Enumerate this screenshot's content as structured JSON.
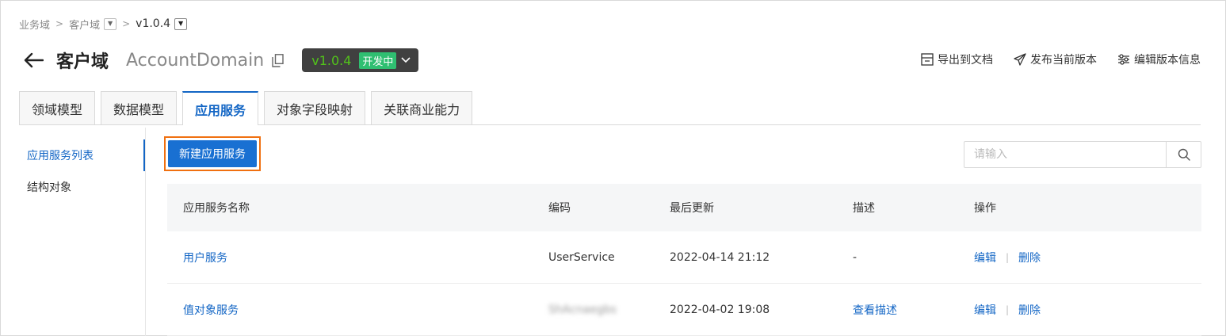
{
  "breadcrumb": {
    "items": [
      "业务域",
      "客户域",
      "v1.0.4"
    ]
  },
  "header": {
    "title": "客户域",
    "subtitle": "AccountDomain",
    "version": "v1.0.4",
    "version_status": "开发中",
    "actions": {
      "export": "导出到文档",
      "publish": "发布当前版本",
      "edit_info": "编辑版本信息"
    }
  },
  "tabs": [
    "领域模型",
    "数据模型",
    "应用服务",
    "对象字段映射",
    "关联商业能力"
  ],
  "active_tab": "应用服务",
  "sidebar": {
    "items": [
      "应用服务列表",
      "结构对象"
    ]
  },
  "toolbar": {
    "create_label": "新建应用服务"
  },
  "search": {
    "placeholder": "请输入"
  },
  "table": {
    "columns": [
      "应用服务名称",
      "编码",
      "最后更新",
      "描述",
      "操作"
    ],
    "rows": [
      {
        "name": "用户服务",
        "code": "UserService",
        "updated": "2022-04-14 21:12",
        "desc": "-",
        "edit": "编辑",
        "delete": "删除"
      },
      {
        "name": "值对象服务",
        "code": "ShAcnaegbs",
        "updated": "2022-04-02 19:08",
        "desc": "查看描述",
        "edit": "编辑",
        "delete": "删除"
      }
    ]
  },
  "colors": {
    "accent": "#1366c5",
    "primary_button": "#1970d2",
    "highlight_border": "#f07010",
    "version_text": "#52c41a",
    "status_badge": "#2fbf71"
  }
}
